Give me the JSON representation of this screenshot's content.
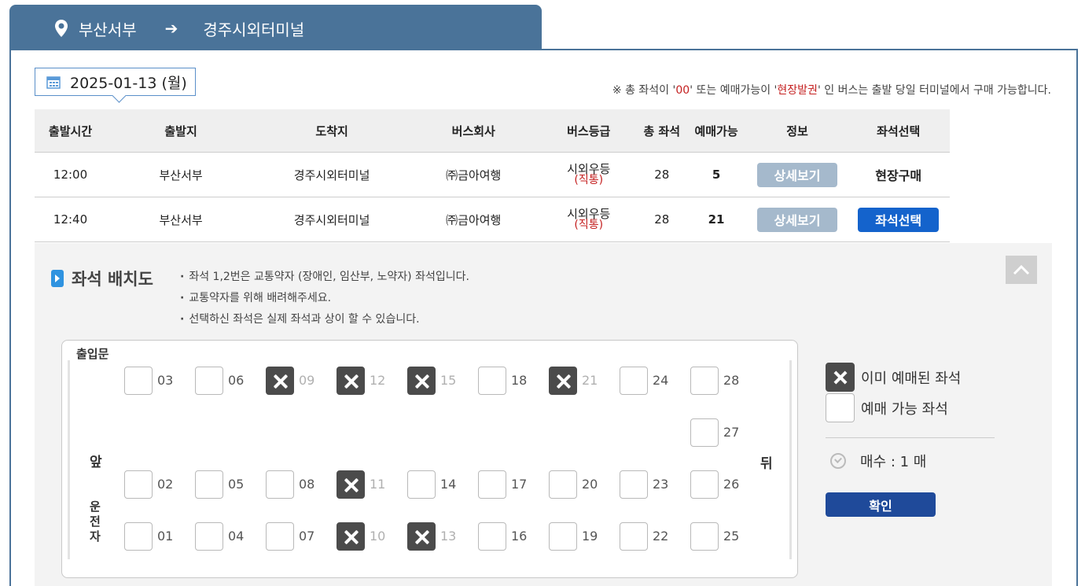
{
  "route": {
    "origin": "부산서부",
    "destination": "경주시외터미널"
  },
  "date": "2025-01-13 (월)",
  "notice": {
    "p1": "※ 총 좌석이 '",
    "v1": "00",
    "p2": "' 또는 예매가능이 '",
    "v2": "현장발권",
    "p3": "' 인 버스는 출발 당일 터미널에서 구매 가능합니다."
  },
  "table": {
    "headers": [
      "출발시간",
      "출발지",
      "도착지",
      "버스회사",
      "버스등급",
      "총 좌석",
      "예매가능",
      "정보",
      "좌석선택"
    ],
    "rows": [
      {
        "time": "12:00",
        "from": "부산서부",
        "to": "경주시외터미널",
        "company": "㈜금아여행",
        "grade": "시외우등",
        "grade_sub": "(직통)",
        "total": "28",
        "available": "5",
        "info": "상세보기",
        "select": "현장구매"
      },
      {
        "time": "12:40",
        "from": "부산서부",
        "to": "경주시외터미널",
        "company": "㈜금아여행",
        "grade": "시외우등",
        "grade_sub": "(직통)",
        "total": "28",
        "available": "21",
        "info": "상세보기",
        "select": "좌석선택"
      }
    ]
  },
  "seat_map": {
    "title": "좌석 배치도",
    "notes": [
      "좌석 1,2번은 교통약자 (장애인, 임산부, 노약자) 좌석입니다.",
      "교통약자를 위해 배려해주세요.",
      "선택하신 좌석은 실제 좌석과 상이 할 수 있습니다."
    ],
    "labels": {
      "door": "출입문",
      "front": "앞",
      "back": "뒤",
      "driver": "운\n전\n자"
    },
    "rows": [
      [
        "03",
        "06",
        "09",
        "12",
        "15",
        "18",
        "21",
        "24",
        "28"
      ],
      [
        "",
        "",
        "",
        "",
        "",
        "",
        "",
        "",
        "27"
      ],
      [
        "02",
        "05",
        "08",
        "11",
        "14",
        "17",
        "20",
        "23",
        "26"
      ],
      [
        "01",
        "04",
        "07",
        "10",
        "13",
        "16",
        "19",
        "22",
        "25"
      ]
    ],
    "taken": [
      "09",
      "12",
      "15",
      "21",
      "11",
      "10",
      "13"
    ]
  },
  "legend": {
    "taken": "이미 예매된 좌석",
    "available": "예매 가능 좌석"
  },
  "count_label": "매수 : 1 매",
  "confirm": "확인"
}
